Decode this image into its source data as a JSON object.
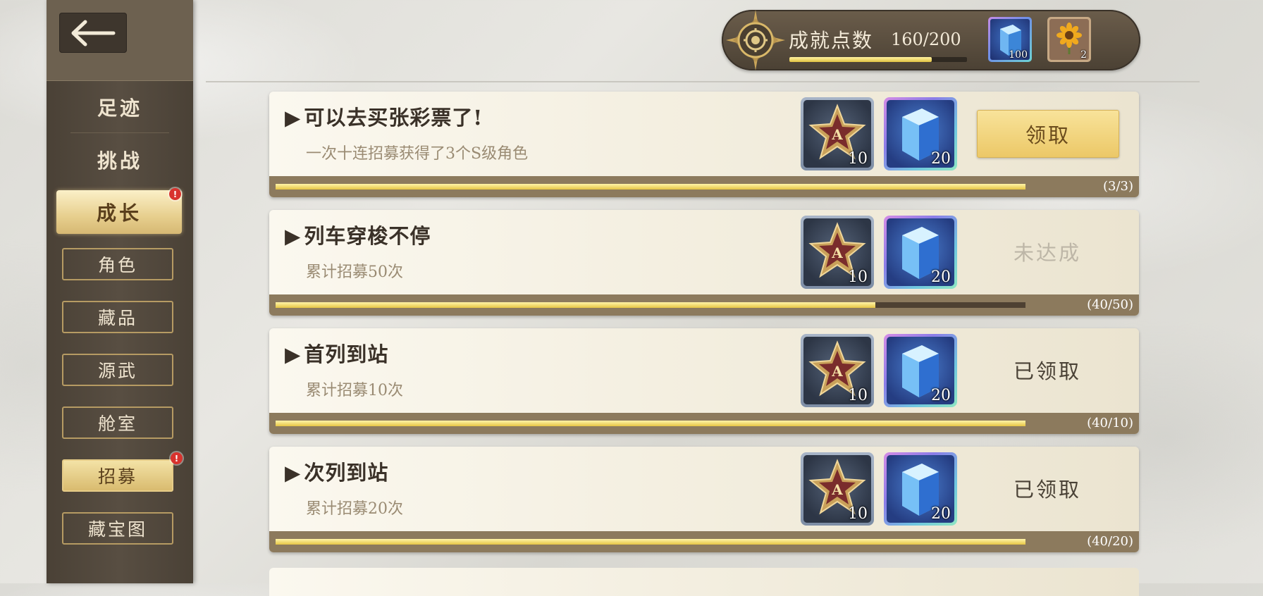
{
  "sidebar": {
    "categories": [
      "足迹",
      "挑战"
    ],
    "active": "成长",
    "active_badge": "!",
    "items": [
      {
        "label": "角色",
        "selected": false,
        "badge": ""
      },
      {
        "label": "藏品",
        "selected": false,
        "badge": ""
      },
      {
        "label": "源武",
        "selected": false,
        "badge": ""
      },
      {
        "label": "舱室",
        "selected": false,
        "badge": ""
      },
      {
        "label": "招募",
        "selected": true,
        "badge": "!"
      },
      {
        "label": "藏宝图",
        "selected": false,
        "badge": ""
      }
    ]
  },
  "header": {
    "points_label": "成就点数",
    "points_value": "160/200",
    "points_progress": 0.8,
    "resources": [
      {
        "icon": "crystal-icon",
        "count": "100"
      },
      {
        "icon": "sunflower-icon",
        "count": "2"
      }
    ]
  },
  "achievements": [
    {
      "title": "可以去买张彩票了!",
      "description": "一次十连招募获得了3个S级角色",
      "rewards": [
        {
          "icon": "a-rank-star-icon",
          "count": "10"
        },
        {
          "icon": "blue-crystal-icon",
          "count": "20"
        }
      ],
      "status": "领取",
      "status_type": "claimable",
      "progress": 1.0,
      "progress_text": "(3/3)"
    },
    {
      "title": "列车穿梭不停",
      "description": "累计招募50次",
      "rewards": [
        {
          "icon": "a-rank-star-icon",
          "count": "10"
        },
        {
          "icon": "blue-crystal-icon",
          "count": "20"
        }
      ],
      "status": "未达成",
      "status_type": "incomplete",
      "progress": 0.8,
      "progress_text": "(40/50)"
    },
    {
      "title": "首列到站",
      "description": "累计招募10次",
      "rewards": [
        {
          "icon": "a-rank-star-icon",
          "count": "10"
        },
        {
          "icon": "blue-crystal-icon",
          "count": "20"
        }
      ],
      "status": "已领取",
      "status_type": "claimed",
      "progress": 1.0,
      "progress_text": "(40/10)"
    },
    {
      "title": "次列到站",
      "description": "累计招募20次",
      "rewards": [
        {
          "icon": "a-rank-star-icon",
          "count": "10"
        },
        {
          "icon": "blue-crystal-icon",
          "count": "20"
        }
      ],
      "status": "已领取",
      "status_type": "claimed",
      "progress": 1.0,
      "progress_text": "(40/20)"
    }
  ],
  "colors": {
    "sidebar_bg": "#4a4136",
    "gold_accent": "#e6c645",
    "notification_red": "#d8332e"
  }
}
